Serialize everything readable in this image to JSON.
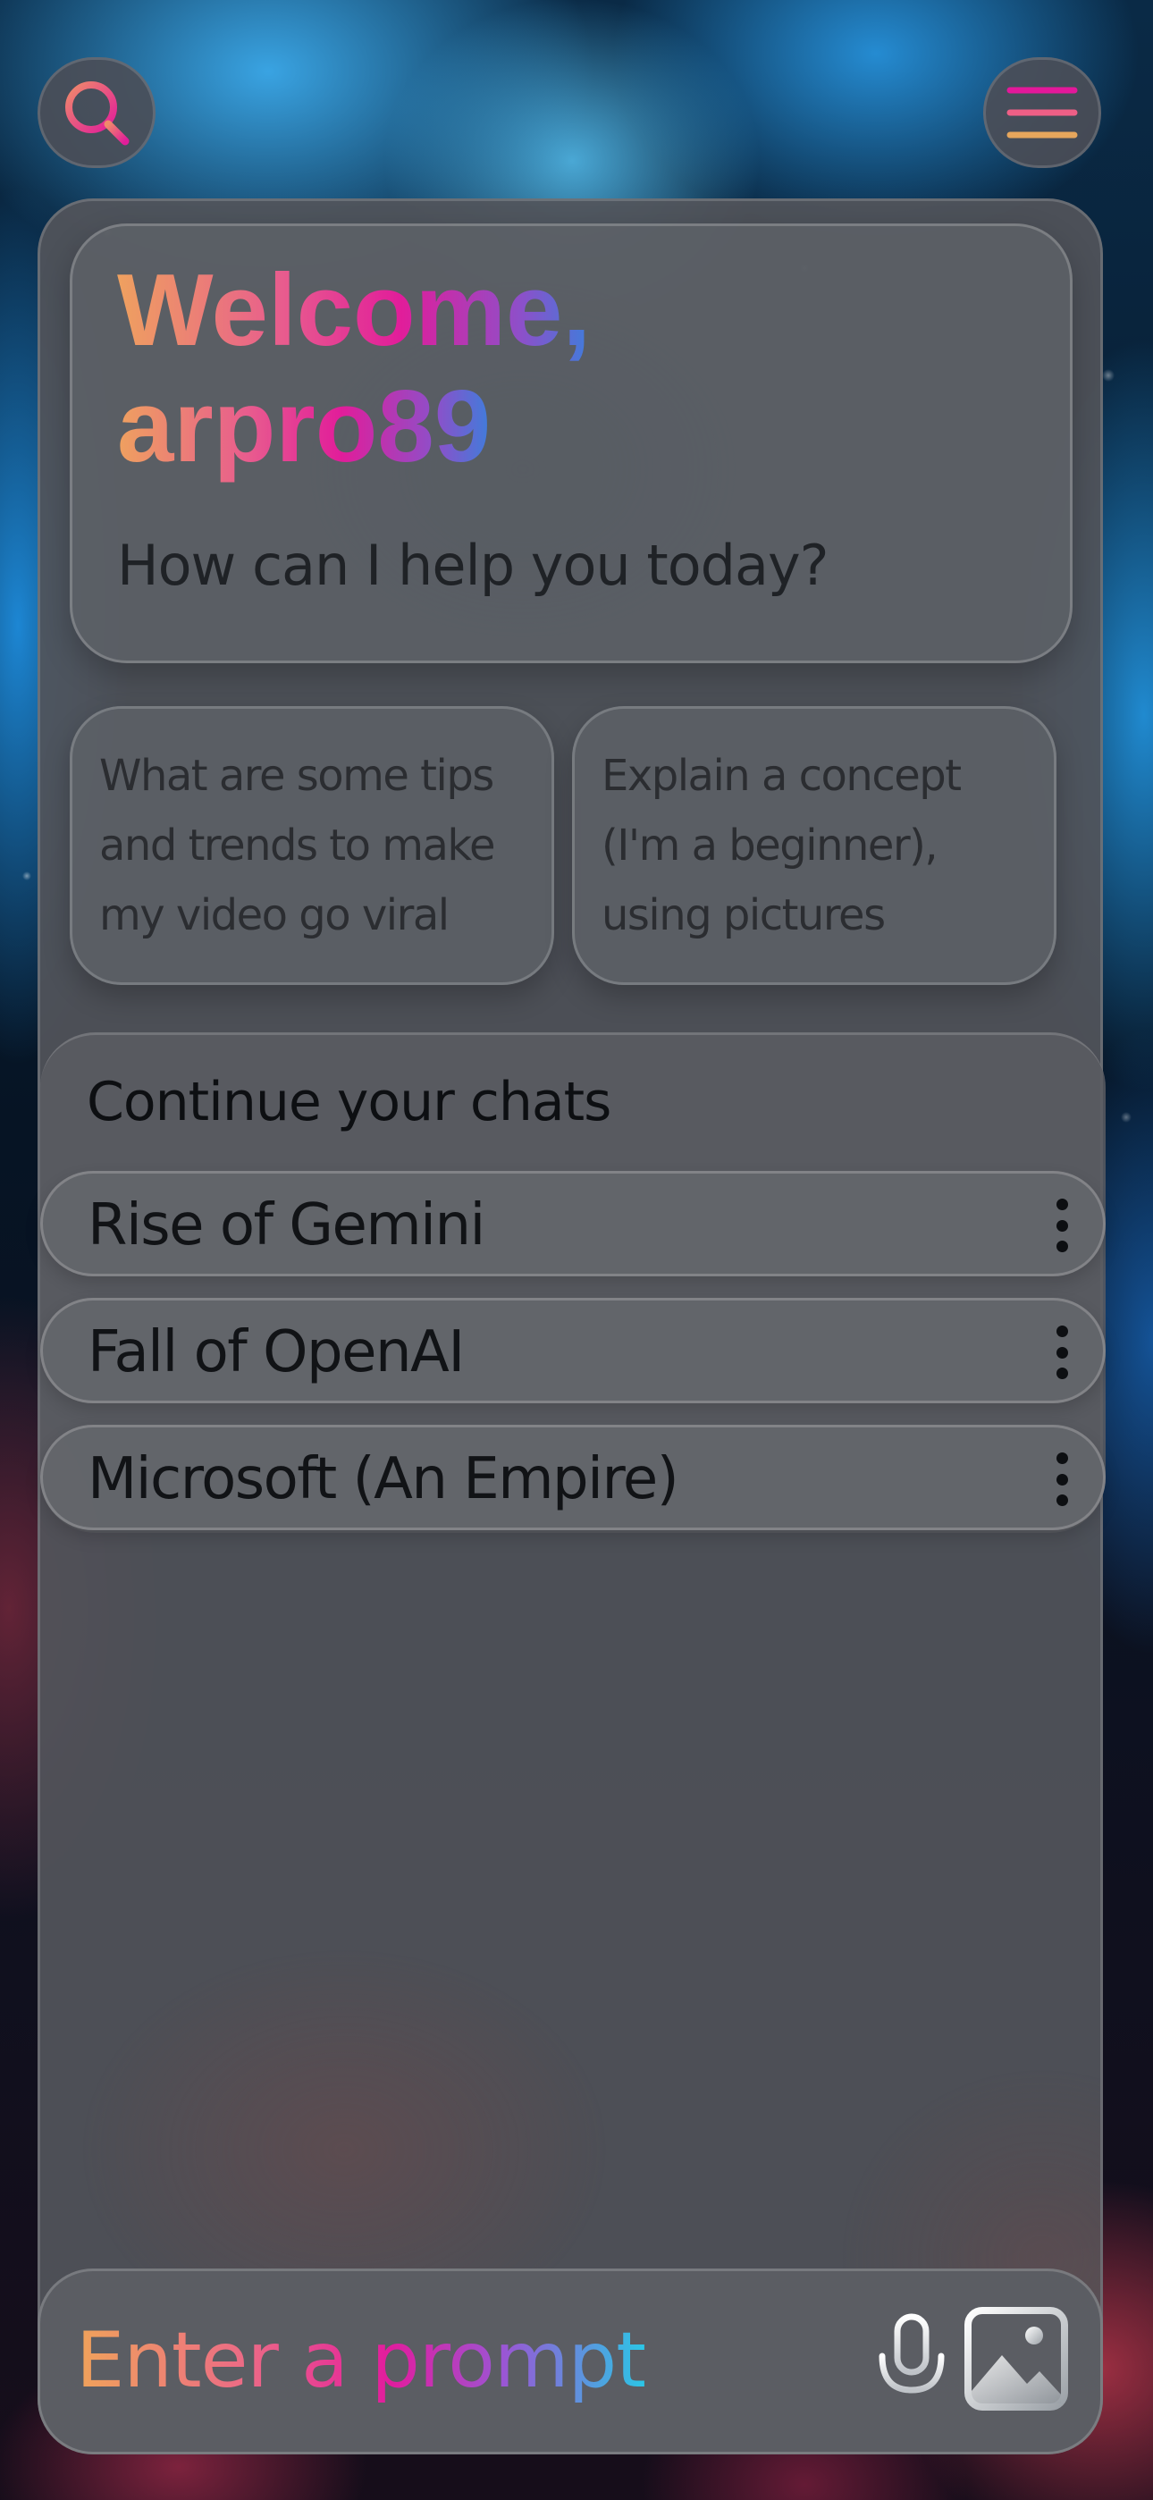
{
  "welcome": {
    "line1": "Welcome,",
    "line2": "arpro89",
    "subtitle": "How can I help you today?"
  },
  "suggestions": [
    {
      "text": "What are some tips and trends to make my video go viral"
    },
    {
      "text": "Explain a concept (I'm a beginner), using pictures"
    }
  ],
  "chats": {
    "title": "Continue your chats",
    "items": [
      {
        "label": "Rise of Gemini"
      },
      {
        "label": "Fall of OpenAI"
      },
      {
        "label": "Microsoft (An Empire)"
      }
    ]
  },
  "prompt": {
    "placeholder": "Enter a prompt"
  },
  "icons": {
    "search": "search-icon",
    "menu": "menu-icon",
    "more": "more-vertical-icon",
    "mic": "microphone-icon",
    "image": "image-icon"
  },
  "colors": {
    "gradient_start": "#efa15f",
    "gradient_mid": "#e11d9a",
    "gradient_end": "#3f7ddb",
    "prompt_gradient_end": "#2bc6e6",
    "panel": "#52545a"
  }
}
